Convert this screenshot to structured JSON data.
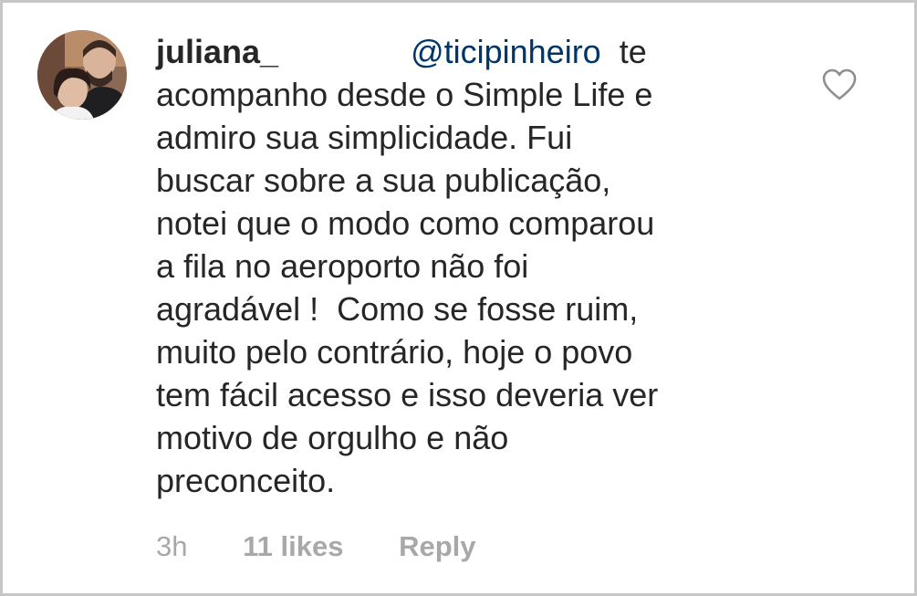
{
  "comment": {
    "username": "juliana_",
    "mention": "@ticipinheiro",
    "lines": [
      "te",
      "acompanho desde o Simple Life e",
      "admiro sua simplicidade. Fui",
      "buscar sobre a sua publicação,",
      "notei que o modo como comparou",
      "a fila no aeroporto não foi",
      "agradável !  Como se fosse ruim,",
      "muito pelo contrário, hoje o povo",
      "tem fácil acesso e isso deveria ver",
      "motivo de orgulho e não",
      "preconceito."
    ]
  },
  "meta": {
    "time": "3h",
    "likes": "11 likes",
    "reply": "Reply"
  },
  "icons": {
    "like": "heart-outline-icon",
    "avatar": "user-avatar"
  }
}
